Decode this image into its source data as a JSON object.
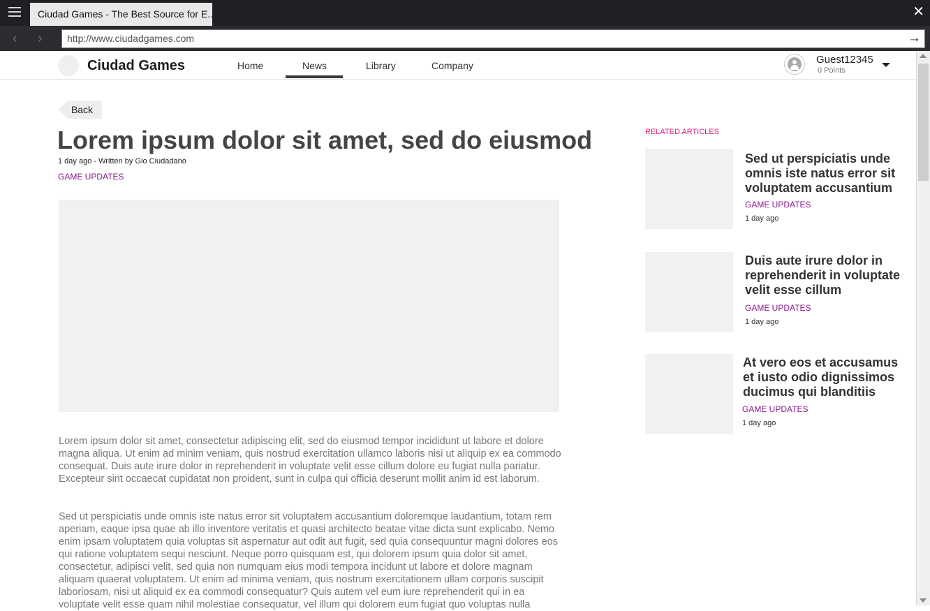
{
  "browser": {
    "tab_title": "Ciudad Games - The Best Source for E...",
    "url": "http://www.ciudadgames.com",
    "back_arrow": "‹",
    "forward_arrow": "›",
    "go_arrow": "→",
    "close_glyph": "✕"
  },
  "header": {
    "site_name": "Ciudad Games",
    "nav": [
      "Home",
      "News",
      "Library",
      "Company"
    ],
    "active_nav": "News",
    "user": {
      "name": "Guest12345",
      "points": "0 Points"
    }
  },
  "article": {
    "back_label": "Back",
    "title": "Lorem ipsum dolor sit amet, sed do eiusmod",
    "meta": "1 day ago - Written by Gio Ciudadano",
    "category": "GAME UPDATES",
    "paragraphs": [
      "Lorem ipsum dolor sit amet, consectetur adipiscing elit, sed do eiusmod tempor incididunt ut labore et dolore magna aliqua. Ut enim ad minim veniam, quis nostrud exercitation ullamco laboris nisi ut aliquip ex ea commodo consequat. Duis aute irure dolor in reprehenderit in voluptate velit esse cillum dolore eu fugiat nulla pariatur. Excepteur sint occaecat cupidatat non proident, sunt in culpa qui officia deserunt mollit anim id est laborum.",
      "Sed ut perspiciatis unde omnis iste natus error sit voluptatem accusantium doloremque laudantium, totam rem aperiam, eaque ipsa quae ab illo inventore veritatis et quasi architecto beatae vitae dicta sunt explicabo. Nemo enim ipsam voluptatem quia voluptas sit aspernatur aut odit aut fugit, sed quia consequuntur magni dolores eos qui ratione voluptatem sequi nesciunt. Neque porro quisquam est, qui dolorem ipsum quia dolor sit amet, consectetur, adipisci velit, sed quia non numquam eius modi tempora incidunt ut labore et dolore magnam aliquam quaerat voluptatem. Ut enim ad minima veniam, quis nostrum exercitationem ullam corporis suscipit laboriosam, nisi ut aliquid ex ea commodi consequatur? Quis autem vel eum iure reprehenderit qui in ea voluptate velit esse quam nihil molestiae consequatur, vel illum qui dolorem eum fugiat quo voluptas nulla"
    ]
  },
  "related": {
    "heading": "RELATED ARTICLES",
    "items": [
      {
        "title": "Sed ut perspiciatis unde omnis iste natus error sit voluptatem accusantium",
        "category": "GAME UPDATES",
        "time": "1 day ago"
      },
      {
        "title": "Duis aute irure dolor in reprehenderit in voluptate velit esse cillum",
        "category": "GAME UPDATES",
        "time": "1 day ago"
      },
      {
        "title": "At vero eos et accusamus et iusto odio dignissimos ducimus qui blanditiis",
        "category": "GAME UPDATES",
        "time": "1 day ago"
      }
    ]
  }
}
